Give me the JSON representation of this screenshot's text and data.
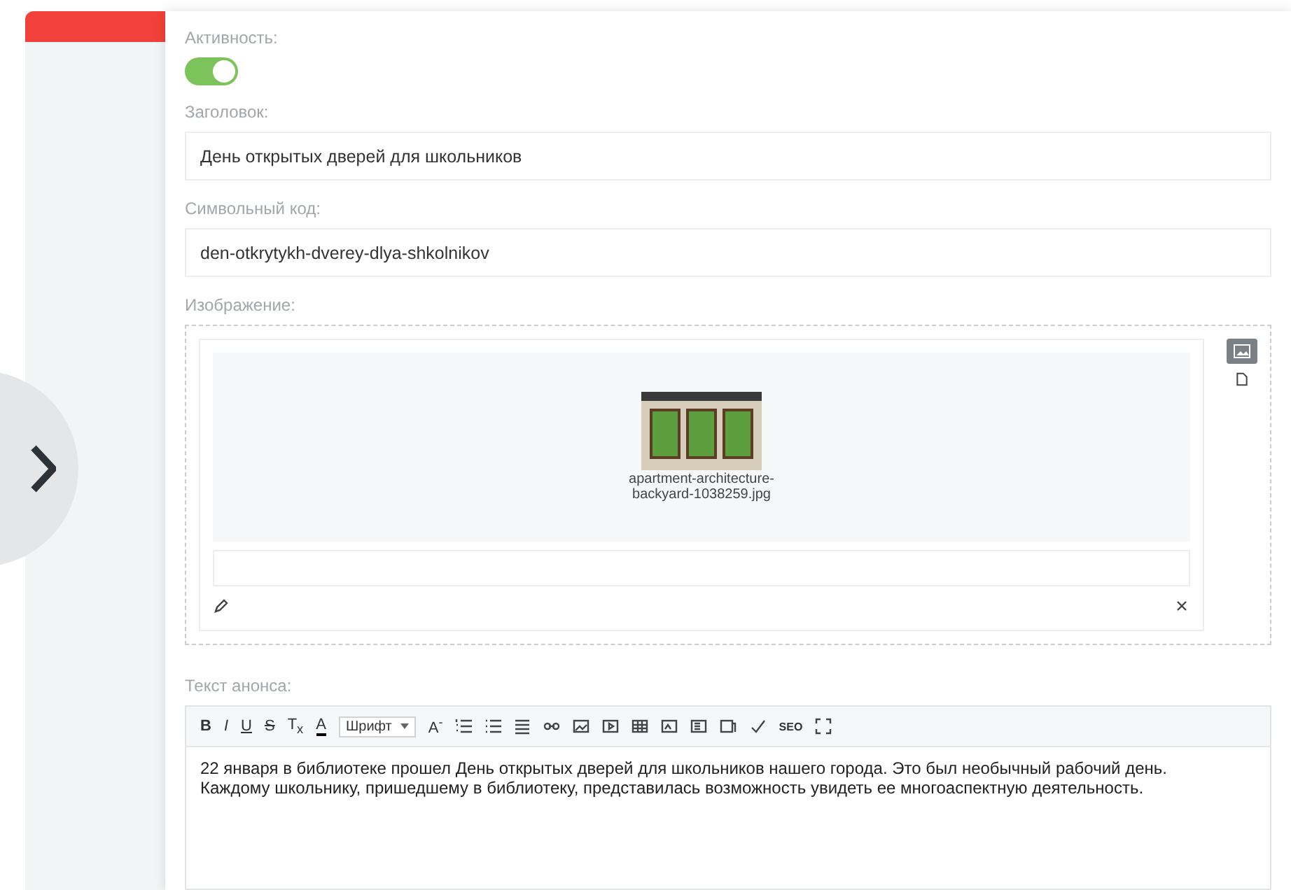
{
  "activity": {
    "label": "Активность:",
    "on": true
  },
  "title_field": {
    "label": "Заголовок:",
    "value": "День открытых дверей для школьников"
  },
  "code_field": {
    "label": "Символьный код:",
    "value": "den-otkrytykh-dverey-dlya-shkolnikov"
  },
  "image": {
    "label": "Изображение:",
    "file_name": "apartment-architecture-backyard-1038259.jpg"
  },
  "announce": {
    "label": "Текст анонса:",
    "toolbar": {
      "format_buttons": [
        "B",
        "I",
        "U",
        "S",
        "T$_{x}$"
      ],
      "font_color": "A",
      "font_select": "Шрифт",
      "font_size": "A$^{-}$",
      "seo": "SEO"
    },
    "text": "22 января в  библиотеке прошел День открытых дверей для школьников нашего города. Это был необычный рабочий день. Каждому школьнику, пришедшему в библиотеку, представилась возможность увидеть ее многоаспектную деятельность."
  }
}
